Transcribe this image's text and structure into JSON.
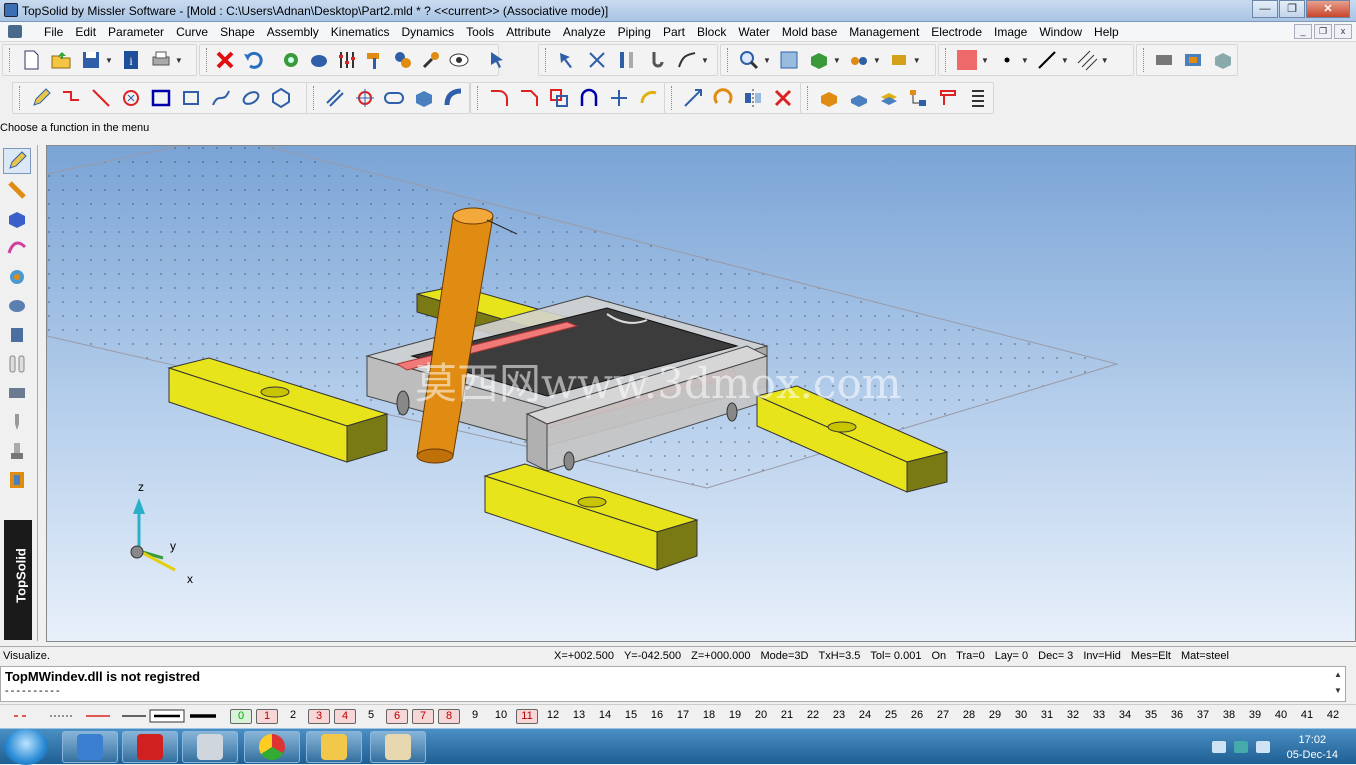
{
  "window": {
    "title": "TopSolid by Missler Software - [Mold : C:\\Users\\Adnan\\Desktop\\Part2.mld * ?  <<current>> (Associative mode)]",
    "min_label": "—",
    "max_label": "❐",
    "close_label": "✕"
  },
  "menu": {
    "items": [
      "File",
      "Edit",
      "Parameter",
      "Curve",
      "Shape",
      "Assembly",
      "Kinematics",
      "Dynamics",
      "Tools",
      "Attribute",
      "Analyze",
      "Piping",
      "Part",
      "Block",
      "Water",
      "Mold base",
      "Management",
      "Electrode",
      "Image",
      "Window",
      "Help"
    ]
  },
  "hint": "Choose a function in the menu",
  "viewport": {
    "watermark": "莫西网www.3dmox.com",
    "axes": {
      "z": "z",
      "y": "y",
      "x": "x"
    },
    "colors": {
      "yellow": "#e8e41c",
      "orange": "#e08c12",
      "gray": "#c8c8c8",
      "dark": "#3c3c3c",
      "pink": "#f07a78"
    }
  },
  "brand": "TopSolid",
  "status": {
    "left": "Visualize.",
    "fields": [
      "X=+002.500",
      "Y=-042.500",
      "Z=+000.000",
      "Mode=3D",
      "TxH=3.5",
      "Tol= 0.001",
      "On",
      "Tra=0",
      "Lay= 0",
      "Dec= 3",
      "Inv=Hid",
      "Mes=Elt",
      "Mat=steel"
    ]
  },
  "messages": {
    "line1": "TopMWindev.dll is not registred",
    "line2": "----------"
  },
  "layers": {
    "numbers": [
      "0",
      "1",
      "2",
      "3",
      "4",
      "5",
      "6",
      "7",
      "8",
      "9",
      "10",
      "11",
      "12",
      "13",
      "14",
      "15",
      "16",
      "17",
      "18",
      "19",
      "20",
      "21",
      "22",
      "23",
      "24",
      "25",
      "26",
      "27",
      "28",
      "29",
      "30",
      "31",
      "32",
      "33",
      "34",
      "35",
      "36",
      "37",
      "38",
      "39",
      "40",
      "41",
      "42"
    ],
    "boxed": [
      "0",
      "1",
      "3",
      "4",
      "6",
      "7",
      "8",
      "11"
    ]
  },
  "taskbar": {
    "time": "17:02",
    "date": "05-Dec-14"
  }
}
